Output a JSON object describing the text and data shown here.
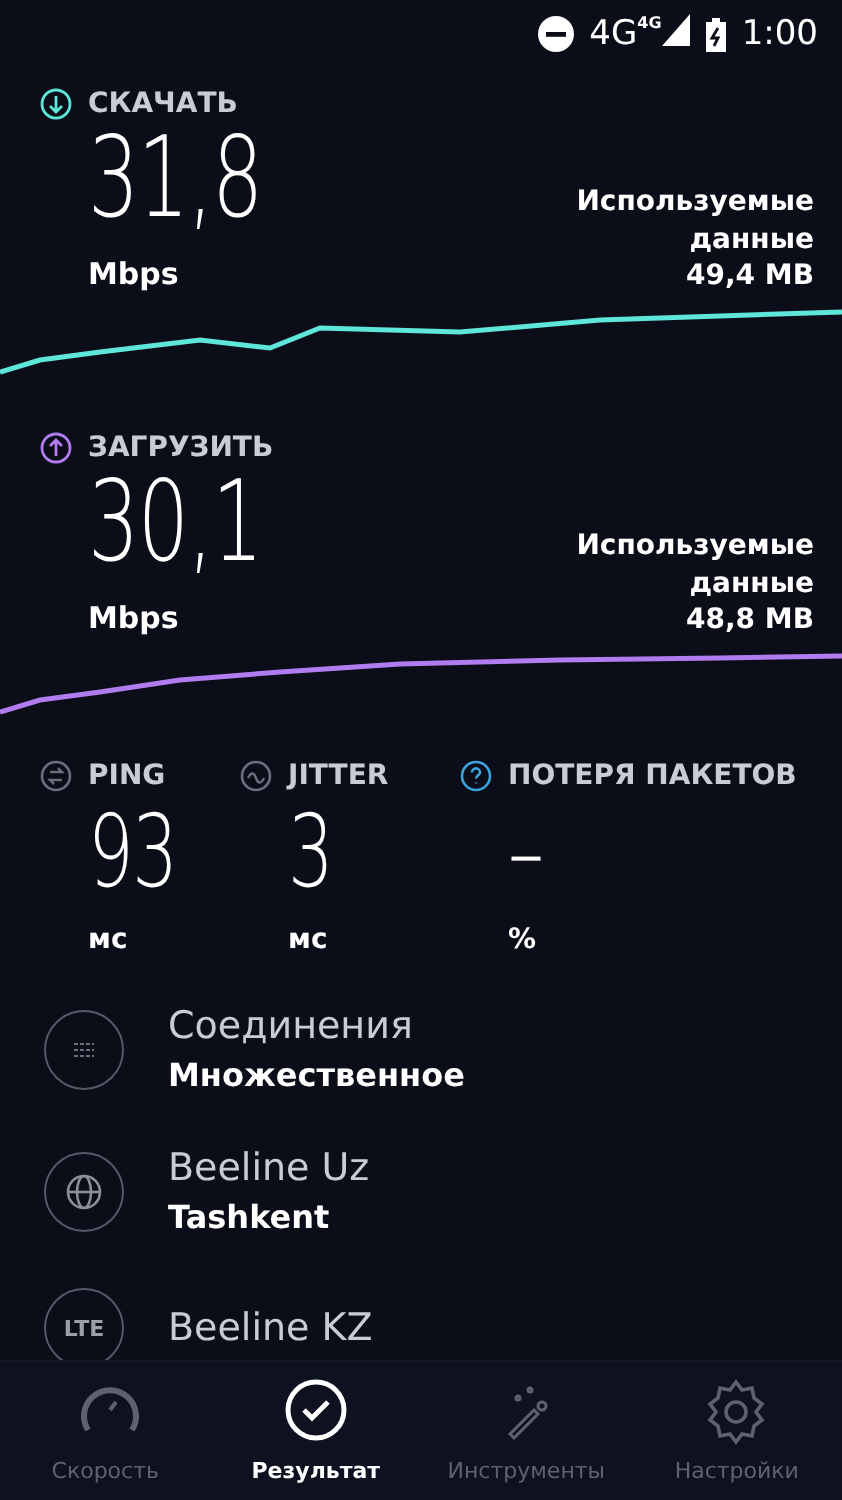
{
  "status_bar": {
    "network": "4G",
    "network_small": "4G",
    "time": "1:00"
  },
  "speeds": [
    {
      "kind": "download",
      "label": "СКАЧАТЬ",
      "value": "31,8",
      "unit": "Mbps",
      "used_label": "Используемые данные",
      "used_value": "49,4 MB",
      "color": "#5ee6d8"
    },
    {
      "kind": "upload",
      "label": "ЗАГРУЗИТЬ",
      "value": "30,1",
      "unit": "Mbps",
      "used_label": "Используемые данные",
      "used_value": "48,8 MB",
      "color": "#b07cf0"
    }
  ],
  "metrics": [
    {
      "kind": "ping",
      "label": "PING",
      "value": "93",
      "unit": "мс"
    },
    {
      "kind": "jitter",
      "label": "JITTER",
      "value": "3",
      "unit": "мс"
    },
    {
      "kind": "loss",
      "label": "ПОТЕРЯ ПАКЕТОВ",
      "value": "–",
      "unit": "%"
    }
  ],
  "details": [
    {
      "kind": "connections",
      "title": "Соединения",
      "subtitle": "Множественное"
    },
    {
      "kind": "globe",
      "title": "Beeline Uz",
      "subtitle": "Tashkent"
    },
    {
      "kind": "lte",
      "badge": "LTE",
      "title": "Beeline KZ"
    }
  ],
  "nav": [
    {
      "kind": "speed",
      "label": "Скорость",
      "selected": false
    },
    {
      "kind": "result",
      "label": "Результат",
      "selected": true
    },
    {
      "kind": "tools",
      "label": "Инструменты",
      "selected": false
    },
    {
      "kind": "settings",
      "label": "Настройки",
      "selected": false
    }
  ]
}
